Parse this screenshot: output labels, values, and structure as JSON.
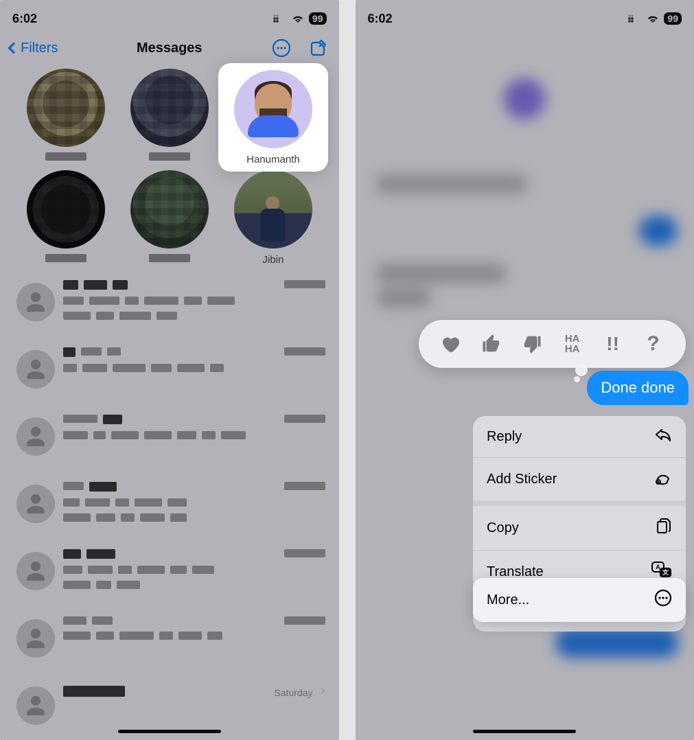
{
  "status": {
    "time": "6:02",
    "battery": "99"
  },
  "left": {
    "nav": {
      "back": "Filters",
      "title": "Messages"
    },
    "pinned": [
      {
        "name": ""
      },
      {
        "name": ""
      },
      {
        "name": "Hanumanth"
      },
      {
        "name": ""
      },
      {
        "name": ""
      },
      {
        "name": "Jibin"
      }
    ],
    "list_time": "Saturday"
  },
  "right": {
    "bubble": "Done done",
    "tapbacks": {
      "haha": "HA\nHA",
      "exclaim": "!!",
      "question": "?"
    },
    "menu": {
      "reply": "Reply",
      "sticker": "Add Sticker",
      "copy": "Copy",
      "translate": "Translate",
      "more": "More..."
    }
  }
}
